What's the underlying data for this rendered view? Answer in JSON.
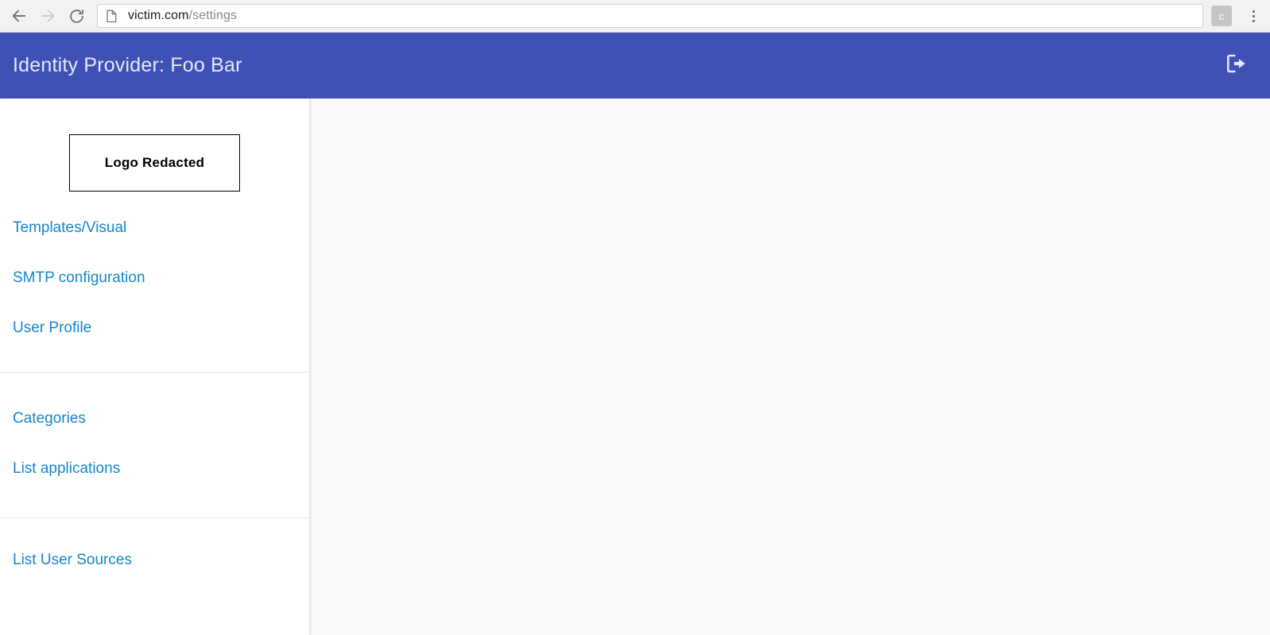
{
  "browser": {
    "back_icon": "arrow-left-icon",
    "forward_icon": "arrow-right-icon",
    "reload_icon": "reload-icon",
    "page_icon": "page-document-icon",
    "url_host": "victim.com",
    "url_path": "/settings",
    "url_full": "victim.com/settings",
    "avatar_label": "c",
    "menu_icon": "three-dot-menu-icon"
  },
  "header": {
    "title": "Identity Provider: Foo Bar",
    "logout_icon": "logout-icon",
    "background_color": "#3f51b5",
    "text_color": "#e6e9f7"
  },
  "sidebar": {
    "logo": {
      "label": "Logo Redacted"
    },
    "link_color": "#1587c9",
    "groups": [
      {
        "items": [
          {
            "label": "Templates/Visual"
          },
          {
            "label": "SMTP configuration"
          },
          {
            "label": "User Profile"
          }
        ]
      },
      {
        "items": [
          {
            "label": "Categories"
          },
          {
            "label": "List applications"
          }
        ]
      },
      {
        "items": [
          {
            "label": "List User Sources"
          }
        ]
      }
    ]
  },
  "content": {
    "background_color": "#f9f9f9"
  }
}
